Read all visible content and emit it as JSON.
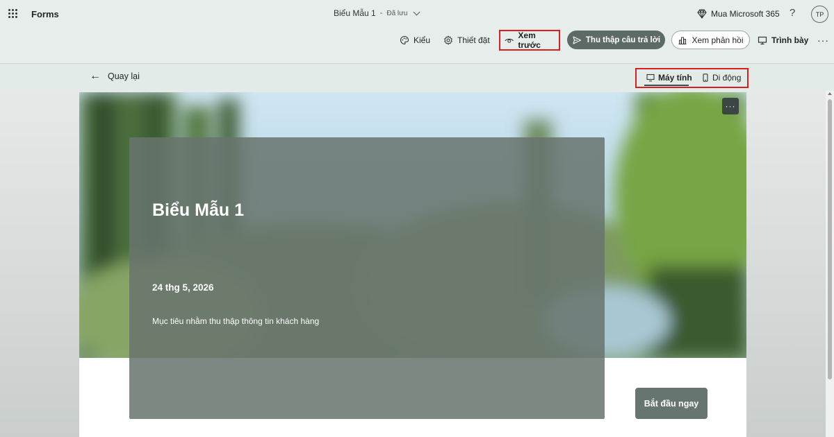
{
  "appbar": {
    "app_name": "Forms",
    "doc_title": "Biểu Mẫu 1",
    "doc_separator": "-",
    "doc_status": "Đã lưu",
    "buy_label": "Mua Microsoft 365",
    "help_label": "?",
    "avatar_initials": "TP"
  },
  "toolbar": {
    "style_label": "Kiểu",
    "settings_label": "Thiết đặt",
    "preview_label": "Xem trước",
    "collect_label": "Thu thập câu trả lời",
    "responses_label": "Xem phản hồi",
    "present_label": "Trình bày",
    "more_label": "···"
  },
  "subbar": {
    "back_label": "Quay lại",
    "desktop_label": "Máy tính",
    "mobile_label": "Di động",
    "selected_device": "desktop"
  },
  "form": {
    "hero_more_label": "···",
    "title": "Biểu Mẫu 1",
    "date": "24 thg 5, 2026",
    "description": "Mục tiêu nhằm thu thập thông tin khách hàng",
    "start_label": "Bắt đầu ngay"
  },
  "colors": {
    "highlight_border": "#d81e1e",
    "primary_button": "#5c6b66",
    "overlay": "#68756e"
  }
}
